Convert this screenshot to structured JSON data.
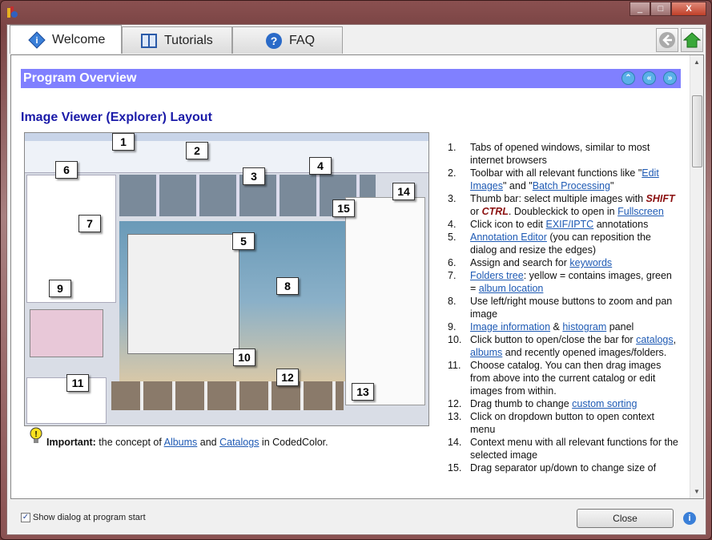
{
  "window": {
    "controls": {
      "minimize": "_",
      "maximize": "□",
      "close": "X"
    }
  },
  "tabs": [
    {
      "label": "Welcome",
      "icon": "info-diamond-icon",
      "active": true
    },
    {
      "label": "Tutorials",
      "icon": "book-icon"
    },
    {
      "label": "FAQ",
      "icon": "question-icon"
    }
  ],
  "section": {
    "title": "Program Overview",
    "icons": [
      "top-icon",
      "prev-icon",
      "next-icon"
    ],
    "icon_glyphs": [
      "⌃",
      "«",
      "»"
    ]
  },
  "subtitle": "Image Viewer (Explorer) Layout",
  "screenshot": {
    "callouts": [
      "1",
      "2",
      "3",
      "4",
      "5",
      "6",
      "7",
      "8",
      "9",
      "10",
      "11",
      "12",
      "13",
      "14",
      "15"
    ]
  },
  "items": [
    [
      {
        "t": "Tabs of opened windows, similar to most internet browsers"
      }
    ],
    [
      {
        "t": "Toolbar with all relevant functions like \""
      },
      {
        "t": "Edit Images",
        "link": true
      },
      {
        "t": "\" and \""
      },
      {
        "t": "Batch Processing",
        "link": true
      },
      {
        "t": "\""
      }
    ],
    [
      {
        "t": "Thumb bar: select multiple images with "
      },
      {
        "t": "SHIFT",
        "em": true
      },
      {
        "t": " or "
      },
      {
        "t": "CTRL",
        "em": true
      },
      {
        "t": ". Doubleckick to open in "
      },
      {
        "t": "Fullscreen",
        "link": true
      }
    ],
    [
      {
        "t": "Click icon to edit "
      },
      {
        "t": "EXIF/IPTC",
        "link": true
      },
      {
        "t": " annotations"
      }
    ],
    [
      {
        "t": "Annotation Editor",
        "link": true
      },
      {
        "t": " (you can reposition the dialog and resize the edges)"
      }
    ],
    [
      {
        "t": "Assign and search for "
      },
      {
        "t": "keywords",
        "link": true
      }
    ],
    [
      {
        "t": "Folders tree",
        "link": true
      },
      {
        "t": ": yellow = contains images, green = "
      },
      {
        "t": "album location",
        "link": true
      }
    ],
    [
      {
        "t": "Use left/right mouse buttons to zoom and pan image"
      }
    ],
    [
      {
        "t": "Image information",
        "link": true
      },
      {
        "t": " & "
      },
      {
        "t": "histogram",
        "link": true
      },
      {
        "t": " panel"
      }
    ],
    [
      {
        "t": "Click button to open/close the bar for "
      },
      {
        "t": "catalogs",
        "link": true
      },
      {
        "t": ", "
      },
      {
        "t": "albums",
        "link": true
      },
      {
        "t": " and recently opened images/folders."
      }
    ],
    [
      {
        "t": "Choose catalog. You can then drag images from above into the current catalog or edit images from within."
      }
    ],
    [
      {
        "t": "Drag thumb to change "
      },
      {
        "t": "custom sorting",
        "link": true
      }
    ],
    [
      {
        "t": "Click on dropdown button to open context menu"
      }
    ],
    [
      {
        "t": "Context menu with all relevant functions for the selected image"
      }
    ],
    [
      {
        "t": "Drag separator up/down to change size of"
      }
    ]
  ],
  "important": {
    "label": "Important:",
    "text1": " the concept of ",
    "link1": "Albums",
    "text2": " and ",
    "link2": "Catalogs",
    "text3": " in CodedColor."
  },
  "footer": {
    "checkbox_label": "Show dialog at program start",
    "checked": true,
    "close_label": "Close"
  }
}
